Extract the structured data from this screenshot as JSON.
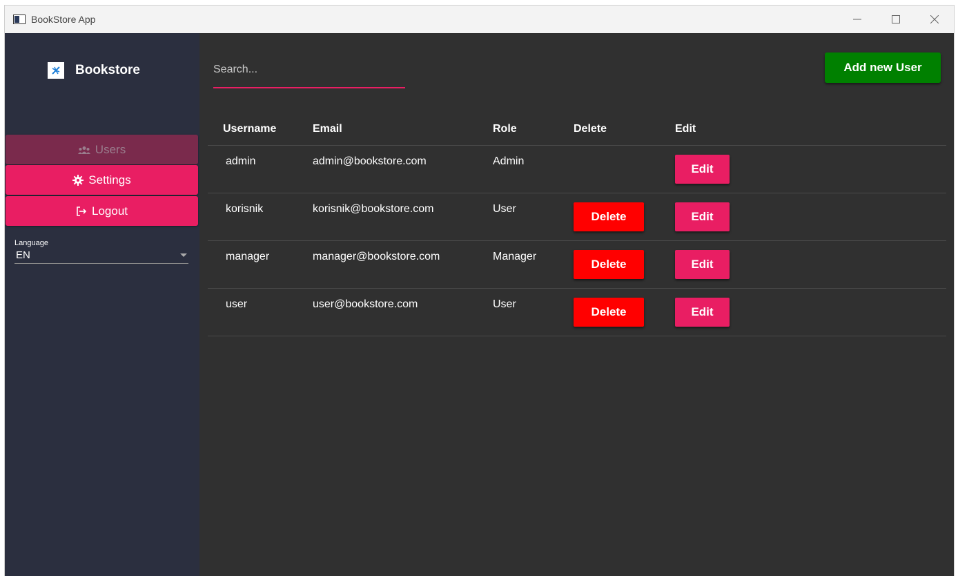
{
  "window": {
    "title": "BookStore App"
  },
  "sidebar": {
    "brand": "Bookstore",
    "nav": [
      {
        "label": "Users",
        "icon": "users-icon",
        "state": "active-disabled"
      },
      {
        "label": "Settings",
        "icon": "gear-icon"
      },
      {
        "label": "Logout",
        "icon": "logout-icon"
      }
    ],
    "language": {
      "label": "Language",
      "value": "EN"
    }
  },
  "main": {
    "search_placeholder": "Search...",
    "add_button_label": "Add new User",
    "table": {
      "headers": [
        "Username",
        "Email",
        "Role",
        "Delete",
        "Edit"
      ],
      "rows": [
        {
          "username": "admin",
          "email": "admin@bookstore.com",
          "role": "Admin",
          "delete_label": "",
          "edit_label": "Edit"
        },
        {
          "username": "korisnik",
          "email": "korisnik@bookstore.com",
          "role": "User",
          "delete_label": "Delete",
          "edit_label": "Edit"
        },
        {
          "username": "manager",
          "email": "manager@bookstore.com",
          "role": "Manager",
          "delete_label": "Delete",
          "edit_label": "Edit"
        },
        {
          "username": "user",
          "email": "user@bookstore.com",
          "role": "User",
          "delete_label": "Delete",
          "edit_label": "Edit"
        }
      ]
    }
  },
  "colors": {
    "accent": "#e91e63",
    "add_button": "#008000",
    "delete_button": "#ff0000",
    "sidebar_bg": "#2b2f3f",
    "main_bg": "#303030"
  }
}
